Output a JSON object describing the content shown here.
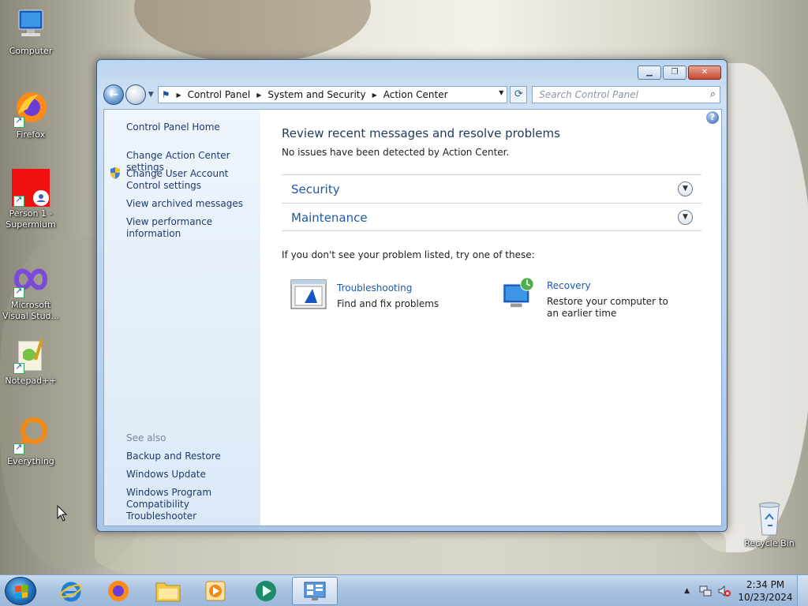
{
  "desktop": {
    "icons": [
      {
        "label": "Computer",
        "icon": "computer-icon"
      },
      {
        "label": "Firefox",
        "icon": "firefox-icon"
      },
      {
        "label": "Person 1 - Supermium",
        "icon": "supermium-icon"
      },
      {
        "label": "Microsoft Visual Stud...",
        "icon": "visual-studio-icon"
      },
      {
        "label": "Notepad++",
        "icon": "notepadpp-icon"
      },
      {
        "label": "Everything",
        "icon": "everything-icon"
      },
      {
        "label": "Recycle Bin",
        "icon": "recycle-bin-icon"
      }
    ]
  },
  "window": {
    "controls": {
      "minimize": "▁",
      "maximize": "❐",
      "close": "✕"
    },
    "address": {
      "crumbs": [
        "Control Panel",
        "System and Security",
        "Action Center"
      ]
    },
    "search": {
      "placeholder": "Search Control Panel"
    },
    "left_pane": {
      "home": "Control Panel Home",
      "links": [
        "Change Action Center settings",
        "Change User Account Control settings",
        "View archived messages",
        "View performance information"
      ],
      "see_also_heading": "See also",
      "see_also": [
        "Backup and Restore",
        "Windows Update",
        "Windows Program Compatibility Troubleshooter"
      ]
    },
    "main": {
      "title": "Review recent messages and resolve problems",
      "subtitle": "No issues have been detected by Action Center.",
      "sections": [
        "Security",
        "Maintenance"
      ],
      "try_line": "If you don't see your problem listed, try one of these:",
      "tools": [
        {
          "title": "Troubleshooting",
          "desc": "Find and fix problems"
        },
        {
          "title": "Recovery",
          "desc": "Restore your computer to an earlier time"
        }
      ]
    }
  },
  "taskbar": {
    "pinned": [
      "internet-explorer-icon",
      "firefox-icon",
      "file-explorer-icon",
      "media-player-icon",
      "app-icon",
      "control-panel-icon"
    ],
    "clock": {
      "time": "2:34 PM",
      "date": "10/23/2024"
    }
  },
  "colors": {
    "link": "#1e5aa8",
    "heading": "#1e395b",
    "pane": "#dbe9f7"
  }
}
